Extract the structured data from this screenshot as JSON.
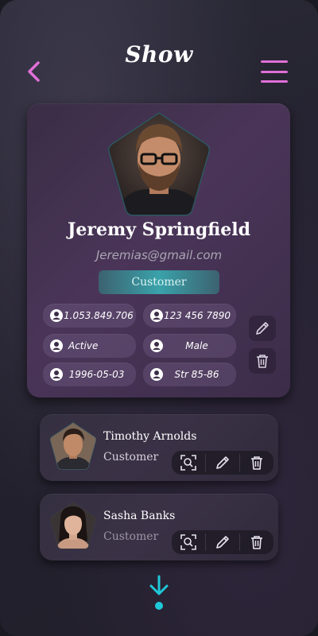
{
  "header": {
    "title": "Show",
    "accent_color": "#e06fd7"
  },
  "profile": {
    "name": "Jeremy Springfield",
    "email": "Jeremias@gmail.com",
    "role": "Customer",
    "fields": {
      "id_number": "1.053.849.706",
      "phone": "123 456 7890",
      "status": "Active",
      "gender": "Male",
      "birthdate": "1996-05-03",
      "address": "Str 85-86"
    }
  },
  "customers": [
    {
      "name": "Timothy Arnolds",
      "role": "Customer"
    },
    {
      "name": "Sasha Banks",
      "role": "Customer"
    }
  ],
  "icons": {
    "back": "chevron-left-icon",
    "menu": "hamburger-menu-icon",
    "user": "user-circle-icon",
    "edit": "pencil-icon",
    "delete": "trash-icon",
    "view": "scan-search-icon",
    "more": "arrow-down-icon"
  },
  "colors": {
    "role_pill": "#3aa2aa",
    "arrow": "#1fc8d8"
  }
}
